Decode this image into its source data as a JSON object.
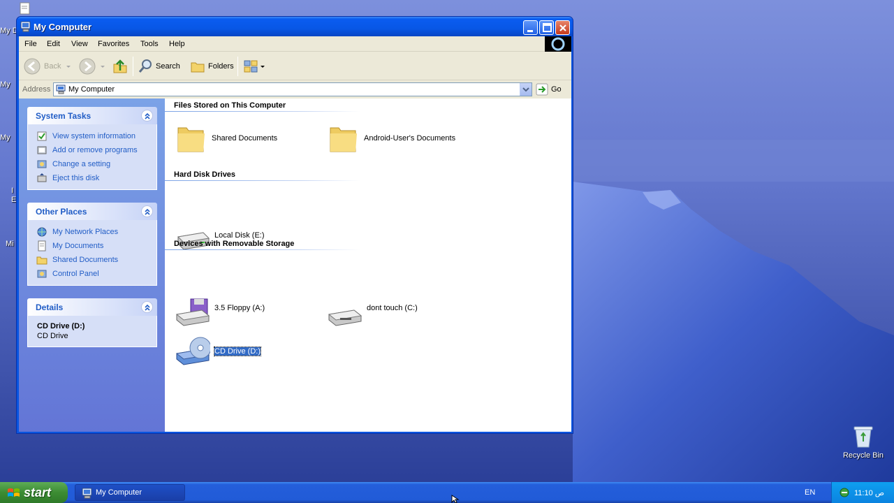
{
  "desktop": {
    "cutoff_labels": [
      "My D",
      "My",
      "My",
      "I",
      "E",
      "Mi"
    ],
    "recycle_bin_label": "Recycle Bin"
  },
  "window": {
    "title": "My Computer",
    "menu": [
      "File",
      "Edit",
      "View",
      "Favorites",
      "Tools",
      "Help"
    ],
    "toolbar": {
      "back_label": "Back",
      "search_label": "Search",
      "folders_label": "Folders"
    },
    "address": {
      "label": "Address",
      "value": "My Computer",
      "go_label": "Go"
    }
  },
  "taskpane": {
    "system_tasks": {
      "title": "System Tasks",
      "items": [
        "View system information",
        "Add or remove programs",
        "Change a setting",
        "Eject this disk"
      ]
    },
    "other_places": {
      "title": "Other Places",
      "items": [
        "My Network Places",
        "My Documents",
        "Shared Documents",
        "Control Panel"
      ]
    },
    "details": {
      "title": "Details",
      "name": "CD Drive (D:)",
      "type": "CD Drive"
    }
  },
  "content": {
    "groups": [
      {
        "title": "Files Stored on This Computer",
        "items": [
          "Shared Documents",
          "Android-User's Documents"
        ]
      },
      {
        "title": "Hard Disk Drives",
        "items": [
          "Local Disk (E:)"
        ]
      },
      {
        "title": "Devices with Removable Storage",
        "items": [
          "3.5 Floppy (A:)",
          "dont touch (C:)",
          "CD Drive (D:)"
        ]
      }
    ],
    "selected_item": "CD Drive (D:)"
  },
  "taskbar": {
    "start_label": "start",
    "task_button_label": "My Computer",
    "language": "EN",
    "clock": "11:10 ص"
  }
}
